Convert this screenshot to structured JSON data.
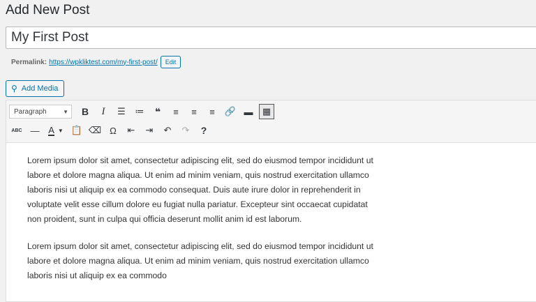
{
  "page": {
    "title": "Add New Post"
  },
  "post": {
    "title_value": "My First Post"
  },
  "permalink": {
    "label": "Permalink:",
    "url": "https://wpkliktest.com/my-first-post/",
    "edit_label": "Edit"
  },
  "media": {
    "add_label": "Add Media"
  },
  "toolbar": {
    "format_select": "Paragraph",
    "row1": [
      {
        "name": "bold-button",
        "glyph": "B"
      },
      {
        "name": "italic-button",
        "glyph": "I"
      },
      {
        "name": "bulleted-list-button",
        "glyph": "☰"
      },
      {
        "name": "numbered-list-button",
        "glyph": "≔"
      },
      {
        "name": "blockquote-button",
        "glyph": "❝"
      },
      {
        "name": "align-left-button",
        "glyph": "≡"
      },
      {
        "name": "align-center-button",
        "glyph": "≡"
      },
      {
        "name": "align-right-button",
        "glyph": "≡"
      },
      {
        "name": "insert-link-button",
        "glyph": "🔗"
      },
      {
        "name": "read-more-button",
        "glyph": "▬"
      },
      {
        "name": "toolbar-toggle-button",
        "glyph": "▦"
      }
    ],
    "row2": [
      {
        "name": "strikethrough-button",
        "glyph": "ABC"
      },
      {
        "name": "horizontal-line-button",
        "glyph": "—"
      },
      {
        "name": "paste-as-text-button",
        "glyph": "📋"
      },
      {
        "name": "clear-formatting-button",
        "glyph": "⌫"
      },
      {
        "name": "special-character-button",
        "glyph": "Ω"
      },
      {
        "name": "decrease-indent-button",
        "glyph": "⇤"
      },
      {
        "name": "increase-indent-button",
        "glyph": "⇥"
      },
      {
        "name": "undo-button",
        "glyph": "↶"
      },
      {
        "name": "redo-button",
        "glyph": "↷"
      },
      {
        "name": "help-button",
        "glyph": "?"
      }
    ],
    "text_color_glyph": "A"
  },
  "content": {
    "paragraphs": [
      "Lorem ipsum dolor sit amet, consectetur adipiscing elit, sed do eiusmod tempor incididunt ut labore et dolore magna aliqua. Ut enim ad minim veniam, quis nostrud exercitation ullamco laboris nisi ut aliquip ex ea commodo consequat. Duis aute irure dolor in reprehenderit in voluptate velit esse cillum dolore eu fugiat nulla pariatur. Excepteur sint occaecat cupidatat non proident, sunt in culpa qui officia deserunt mollit anim id est laborum.",
      "Lorem ipsum dolor sit amet, consectetur adipiscing elit, sed do eiusmod tempor incididunt ut labore et dolore magna aliqua. Ut enim ad minim veniam, quis nostrud exercitation ullamco laboris nisi ut aliquip ex ea commodo"
    ]
  },
  "colors": {
    "accent": "#0073aa",
    "background": "#f1f1f1"
  }
}
